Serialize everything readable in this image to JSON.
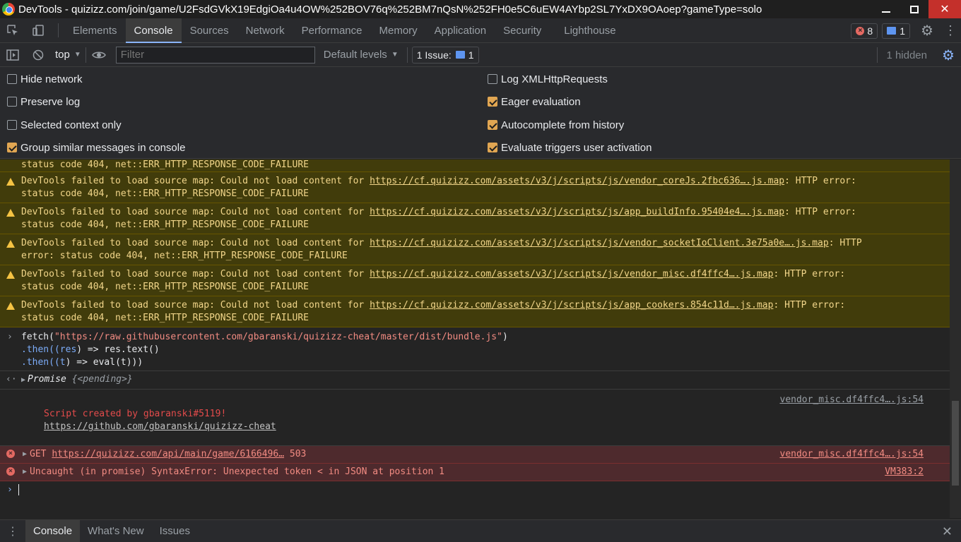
{
  "window": {
    "title": "DevTools - quizizz.com/join/game/U2FsdGVkX19EdgiOa4u4OW%252BOV76q%252BM7nQsN%252FH0e5C6uEW4AYbp2SL7YxDX9OAoep?gameType=solo",
    "minimize_label": "",
    "close_label": "✕"
  },
  "tabs": [
    {
      "label": "Elements"
    },
    {
      "label": "Console"
    },
    {
      "label": "Sources"
    },
    {
      "label": "Network"
    },
    {
      "label": "Performance"
    },
    {
      "label": "Memory"
    },
    {
      "label": "Application"
    },
    {
      "label": "Security"
    },
    {
      "label": "Lighthouse"
    }
  ],
  "badges": {
    "errors": "8",
    "messages": "1"
  },
  "toolbar": {
    "context": "top",
    "filter_placeholder": "Filter",
    "levels": "Default levels",
    "issues_label": "1 Issue:",
    "issues_count": "1",
    "hidden": "1 hidden"
  },
  "settings": {
    "hide_network": "Hide network",
    "preserve_log": "Preserve log",
    "selected_context": "Selected context only",
    "group_similar": "Group similar messages in console",
    "log_xhr": "Log XMLHttpRequests",
    "eager_eval": "Eager evaluation",
    "autocomplete": "Autocomplete from history",
    "eval_triggers": "Evaluate triggers user activation"
  },
  "console": {
    "partial_warning_tail": "status code 404, net::ERR_HTTP_RESPONSE_CODE_FAILURE",
    "warn_prefix": "DevTools failed to load source map: Could not load content for ",
    "warnings": [
      {
        "url": "https://cf.quizizz.com/assets/v3/j/scripts/js/vendor_coreJs.2fbc636….js.map",
        "suffix": ": HTTP error:",
        "line2": "status code 404, net::ERR_HTTP_RESPONSE_CODE_FAILURE"
      },
      {
        "url": "https://cf.quizizz.com/assets/v3/j/scripts/js/app_buildInfo.95404e4….js.map",
        "suffix": ": HTTP error:",
        "line2": "status code 404, net::ERR_HTTP_RESPONSE_CODE_FAILURE"
      },
      {
        "url": "https://cf.quizizz.com/assets/v3/j/scripts/js/vendor_socketIoClient.3e75a0e….js.map",
        "suffix": ": HTTP",
        "line2": "error: status code 404, net::ERR_HTTP_RESPONSE_CODE_FAILURE"
      },
      {
        "url": "https://cf.quizizz.com/assets/v3/j/scripts/js/vendor_misc.df4ffc4….js.map",
        "suffix": ": HTTP error:",
        "line2": "status code 404, net::ERR_HTTP_RESPONSE_CODE_FAILURE"
      },
      {
        "url": "https://cf.quizizz.com/assets/v3/j/scripts/js/app_cookers.854c11d….js.map",
        "suffix": ": HTTP error:",
        "line2": "status code 404, net::ERR_HTTP_RESPONSE_CODE_FAILURE"
      }
    ],
    "input": {
      "fetch_fn": "fetch(",
      "fetch_url": "\"https://raw.githubusercontent.com/gbaranski/quizizz-cheat/master/dist/bundle.js\"",
      "fetch_close": ")",
      "line2_pre": ".then((",
      "line2_param": "res",
      "line2_post": ") => res.text()",
      "line3_pre": ".then((",
      "line3_param": "t",
      "line3_post": ") => eval(t)))"
    },
    "result": {
      "name": "Promise",
      "state": "{<pending>}"
    },
    "log": {
      "line1": "Script created by gbaranski#5119!",
      "line2": "https://github.com/gbaranski/quizizz-cheat",
      "source": "vendor_misc.df4ffc4….js:54"
    },
    "errors": [
      {
        "method": "GET",
        "url": "https://quizizz.com/api/main/game/6166496…",
        "status": "503",
        "source": "vendor_misc.df4ffc4….js:54"
      },
      {
        "text": "Uncaught (in promise) SyntaxError: Unexpected token < in JSON at position 1",
        "source": "VM383:2"
      }
    ]
  },
  "drawer": {
    "tabs": [
      {
        "label": "Console"
      },
      {
        "label": "What's New"
      },
      {
        "label": "Issues"
      }
    ]
  }
}
